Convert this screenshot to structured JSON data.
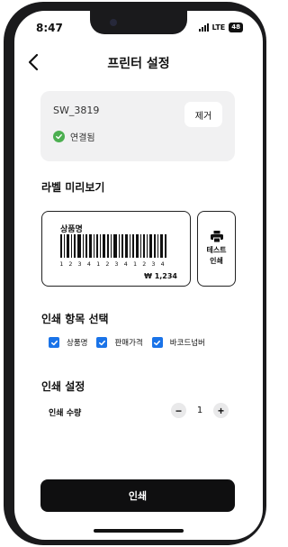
{
  "status_bar": {
    "time": "8:47",
    "network": "LTE",
    "battery": "48"
  },
  "header": {
    "title": "프린터 설정",
    "back_icon": "chevron-left-icon"
  },
  "printer": {
    "name": "SW_3819",
    "status": "연결됨",
    "status_icon": "check-circle-icon",
    "status_color": "#4caf50",
    "remove_label": "제거"
  },
  "preview": {
    "section_title": "라벨 미리보기",
    "product_name": "상품명",
    "barcode_digits": "1 2 3 4 1 2 3 4 1 2 3 4",
    "price": "₩ 1,234",
    "test_print_line1": "테스트",
    "test_print_line2": "인쇄",
    "test_print_icon": "printer-icon"
  },
  "print_items": {
    "section_title": "인쇄 항목 선택",
    "options": [
      {
        "label": "상품명",
        "checked": true
      },
      {
        "label": "판매가격",
        "checked": true
      },
      {
        "label": "바코드넘버",
        "checked": true
      }
    ],
    "accent_color": "#1a73e8"
  },
  "print_settings": {
    "section_title": "인쇄 설정",
    "quantity_label": "인쇄 수량",
    "quantity": "1",
    "decrement": "−",
    "increment": "+"
  },
  "actions": {
    "print_label": "인쇄"
  }
}
